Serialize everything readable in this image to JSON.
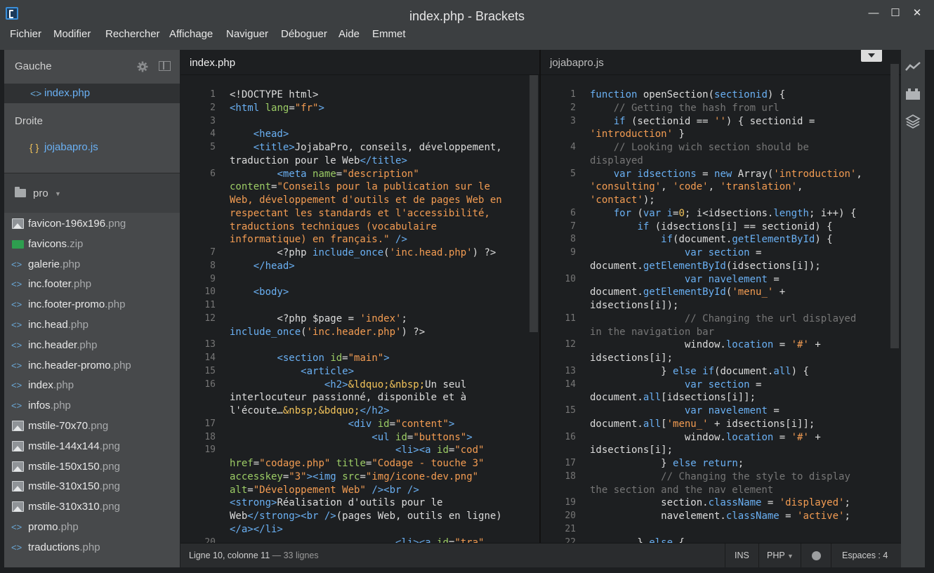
{
  "window": {
    "title": "index.php - Brackets",
    "minimize": "—",
    "maximize": "☐",
    "close": "✕"
  },
  "menu": [
    "Fichier",
    "Modifier",
    "Rechercher",
    "Affichage",
    "Naviguer",
    "Déboguer",
    "Aide",
    "Emmet"
  ],
  "sidebar": {
    "left_label": "Gauche",
    "left_file": {
      "icon": "<>",
      "name": "index.php"
    },
    "right_label": "Droite",
    "right_file": {
      "icon": "{ }",
      "name": "jojabapro.js"
    },
    "project": "pro",
    "files": [
      {
        "name": "favicon-196x196",
        "ext": ".png",
        "type": "image"
      },
      {
        "name": "favicons",
        "ext": ".zip",
        "type": "zip"
      },
      {
        "name": "galerie",
        "ext": ".php",
        "type": "code"
      },
      {
        "name": "inc.footer",
        "ext": ".php",
        "type": "code"
      },
      {
        "name": "inc.footer-promo",
        "ext": ".php",
        "type": "code"
      },
      {
        "name": "inc.head",
        "ext": ".php",
        "type": "code"
      },
      {
        "name": "inc.header",
        "ext": ".php",
        "type": "code"
      },
      {
        "name": "inc.header-promo",
        "ext": ".php",
        "type": "code"
      },
      {
        "name": "index",
        "ext": ".php",
        "type": "code"
      },
      {
        "name": "infos",
        "ext": ".php",
        "type": "code"
      },
      {
        "name": "mstile-70x70",
        "ext": ".png",
        "type": "image"
      },
      {
        "name": "mstile-144x144",
        "ext": ".png",
        "type": "image"
      },
      {
        "name": "mstile-150x150",
        "ext": ".png",
        "type": "image"
      },
      {
        "name": "mstile-310x150",
        "ext": ".png",
        "type": "image"
      },
      {
        "name": "mstile-310x310",
        "ext": ".png",
        "type": "image"
      },
      {
        "name": "promo",
        "ext": ".php",
        "type": "code"
      },
      {
        "name": "traductions",
        "ext": ".php",
        "type": "code"
      }
    ]
  },
  "left_pane": {
    "title": "index.php",
    "lines": [
      {
        "n": "1",
        "h": "&lt;!DOCTYPE html&gt;"
      },
      {
        "n": "2",
        "h": "<span class='tg'>&lt;html</span> <span class='at'>lang</span>=<span class='st'>\"fr\"</span><span class='tg'>&gt;</span>"
      },
      {
        "n": "3",
        "h": ""
      },
      {
        "n": "4",
        "h": "    <span class='tg'>&lt;head&gt;</span>"
      },
      {
        "n": "5",
        "h": "    <span class='tg'>&lt;title&gt;</span>JojabaPro, conseils, développement,"
      },
      {
        "n": "",
        "h": "traduction pour le Web<span class='tg'>&lt;/title&gt;</span>"
      },
      {
        "n": "6",
        "h": "        <span class='tg'>&lt;meta</span> <span class='at'>name</span>=<span class='st'>\"description\"</span>"
      },
      {
        "n": "",
        "h": "<span class='at'>content</span>=<span class='st'>\"Conseils pour la publication sur le</span>"
      },
      {
        "n": "",
        "h": "<span class='st'>Web, développement d'outils et de pages Web en</span>"
      },
      {
        "n": "",
        "h": "<span class='st'>respectant les standards et l'accessibilité,</span>"
      },
      {
        "n": "",
        "h": "<span class='st'>traductions techniques (vocabulaire</span>"
      },
      {
        "n": "",
        "h": "<span class='st'>informatique) en français.\"</span> <span class='tg'>/&gt;</span>"
      },
      {
        "n": "7",
        "h": "        &lt;?php <span class='kw'>include_once</span>(<span class='st'>'inc.head.php'</span>) ?&gt;"
      },
      {
        "n": "8",
        "h": "    <span class='tg'>&lt;/head&gt;</span>"
      },
      {
        "n": "9",
        "h": ""
      },
      {
        "n": "10",
        "h": "    <span class='tg'>&lt;body&gt;</span>"
      },
      {
        "n": "11",
        "h": ""
      },
      {
        "n": "12",
        "h": "        &lt;?php $page = <span class='st'>'index'</span>;"
      },
      {
        "n": "",
        "h": "<span class='kw'>include_once</span>(<span class='st'>'inc.header.php'</span>) ?&gt;"
      },
      {
        "n": "13",
        "h": ""
      },
      {
        "n": "14",
        "h": "        <span class='tg'>&lt;section</span> <span class='at'>id</span>=<span class='st'>\"main\"</span><span class='tg'>&gt;</span>"
      },
      {
        "n": "15",
        "h": "            <span class='tg'>&lt;article&gt;</span>"
      },
      {
        "n": "16",
        "h": "                <span class='tg'>&lt;h2&gt;</span><span class='nm'>&amp;ldquo;&amp;nbsp;</span>Un seul"
      },
      {
        "n": "",
        "h": "interlocuteur passionné, disponible et à"
      },
      {
        "n": "",
        "h": "l'écoute…<span class='nm'>&amp;nbsp;&amp;bdquo;</span><span class='tg'>&lt;/h2&gt;</span>"
      },
      {
        "n": "17",
        "h": "                    <span class='tg'>&lt;div</span> <span class='at'>id</span>=<span class='st'>\"content\"</span><span class='tg'>&gt;</span>"
      },
      {
        "n": "18",
        "h": "                        <span class='tg'>&lt;ul</span> <span class='at'>id</span>=<span class='st'>\"buttons\"</span><span class='tg'>&gt;</span>"
      },
      {
        "n": "19",
        "h": "                            <span class='tg'>&lt;li&gt;&lt;a</span> <span class='at'>id</span>=<span class='st'>\"cod\"</span>"
      },
      {
        "n": "",
        "h": "<span class='at'>href</span>=<span class='st'>\"codage.php\"</span> <span class='at'>title</span>=<span class='st'>\"Codage - touche 3\"</span>"
      },
      {
        "n": "",
        "h": "<span class='at'>accesskey</span>=<span class='st'>\"3\"</span><span class='tg'>&gt;&lt;img</span> <span class='at'>src</span>=<span class='st'>\"img/icone-dev.png\"</span>"
      },
      {
        "n": "",
        "h": "<span class='at'>alt</span>=<span class='st'>\"Développement Web\"</span> <span class='tg'>/&gt;&lt;br /&gt;</span>"
      },
      {
        "n": "",
        "h": "<span class='tg'>&lt;strong&gt;</span>Réalisation d'outils pour le"
      },
      {
        "n": "",
        "h": "Web<span class='tg'>&lt;/strong&gt;&lt;br /&gt;</span>(pages Web, outils en ligne)"
      },
      {
        "n": "",
        "h": "<span class='tg'>&lt;/a&gt;&lt;/li&gt;</span>"
      },
      {
        "n": "20",
        "h": "                            <span class='tg'>&lt;li&gt;&lt;a</span> <span class='at'>id</span>=<span class='st'>\"tra\"</span>"
      }
    ]
  },
  "right_pane": {
    "title": "jojabapro.js",
    "lines": [
      {
        "n": "1",
        "h": "<span class='kw'>function</span> openSection(<span class='kw'>sectionid</span>) {"
      },
      {
        "n": "2",
        "h": "    <span class='cm'>// Getting the hash from url</span>"
      },
      {
        "n": "3",
        "h": "    <span class='kw'>if</span> (sectionid == <span class='st'>''</span>) { sectionid ="
      },
      {
        "n": "",
        "h": "<span class='st'>'introduction'</span> }"
      },
      {
        "n": "4",
        "h": "    <span class='cm'>// Looking wich section should be</span>"
      },
      {
        "n": "",
        "h": "<span class='cm'>displayed</span>"
      },
      {
        "n": "5",
        "h": "    <span class='kw'>var</span> <span class='kw'>idsections</span> = <span class='kw'>new</span> Array(<span class='st'>'introduction'</span>,"
      },
      {
        "n": "",
        "h": "<span class='st'>'consulting'</span>, <span class='st'>'code'</span>, <span class='st'>'translation'</span>,"
      },
      {
        "n": "",
        "h": "<span class='st'>'contact'</span>);"
      },
      {
        "n": "6",
        "h": "    <span class='kw'>for</span> (<span class='kw'>var</span> <span class='kw'>i</span>=<span class='nm'>0</span>; i&lt;idsections.<span class='kw'>length</span>; i++) {"
      },
      {
        "n": "7",
        "h": "        <span class='kw'>if</span> (idsections[i] == sectionid) {"
      },
      {
        "n": "8",
        "h": "            <span class='kw'>if</span>(document.<span class='kw'>getElementById</span>) {"
      },
      {
        "n": "9",
        "h": "                <span class='kw'>var</span> <span class='kw'>section</span> ="
      },
      {
        "n": "",
        "h": "document.<span class='kw'>getElementById</span>(idsections[i]);"
      },
      {
        "n": "10",
        "h": "                <span class='kw'>var</span> <span class='kw'>navelement</span> ="
      },
      {
        "n": "",
        "h": "document.<span class='kw'>getElementById</span>(<span class='st'>'menu_'</span> +"
      },
      {
        "n": "",
        "h": "idsections[i]);"
      },
      {
        "n": "11",
        "h": "                <span class='cm'>// Changing the url displayed</span>"
      },
      {
        "n": "",
        "h": "<span class='cm'>in the navigation bar</span>"
      },
      {
        "n": "12",
        "h": "                window.<span class='kw'>location</span> = <span class='st'>'#'</span> +"
      },
      {
        "n": "",
        "h": "idsections[i];"
      },
      {
        "n": "13",
        "h": "            } <span class='kw'>else</span> <span class='kw'>if</span>(document.<span class='kw'>all</span>) {"
      },
      {
        "n": "14",
        "h": "                <span class='kw'>var</span> <span class='kw'>section</span> ="
      },
      {
        "n": "",
        "h": "document.<span class='kw'>all</span>[idsections[i]];"
      },
      {
        "n": "15",
        "h": "                <span class='kw'>var</span> <span class='kw'>navelement</span> ="
      },
      {
        "n": "",
        "h": "document.<span class='kw'>all</span>[<span class='st'>'menu_'</span> + idsections[i]];"
      },
      {
        "n": "16",
        "h": "                window.<span class='kw'>location</span> = <span class='st'>'#'</span> +"
      },
      {
        "n": "",
        "h": "idsections[i];"
      },
      {
        "n": "17",
        "h": "            } <span class='kw'>else</span> <span class='kw'>return</span>;"
      },
      {
        "n": "18",
        "h": "            <span class='cm'>// Changing the style to display</span>"
      },
      {
        "n": "",
        "h": "<span class='cm'>the section and the nav element</span>"
      },
      {
        "n": "19",
        "h": "            section.<span class='kw'>className</span> = <span class='st'>'displayed'</span>;"
      },
      {
        "n": "20",
        "h": "            navelement.<span class='kw'>className</span> = <span class='st'>'active'</span>;"
      },
      {
        "n": "21",
        "h": ""
      },
      {
        "n": "22",
        "h": "        } <span class='kw'>else</span> {"
      }
    ]
  },
  "status": {
    "cursor": "Ligne 10, colonne 11",
    "lines": " — 33 lignes",
    "mode": "INS",
    "language": "PHP",
    "indent": "Espaces : 4"
  },
  "toolbar": [
    "live-preview-icon",
    "extension-manager-icon",
    "layers-icon"
  ],
  "colors": {
    "accent": "#6ab0f3",
    "string": "#f39c52",
    "attribute": "#9ccc65",
    "comment": "#767676"
  }
}
